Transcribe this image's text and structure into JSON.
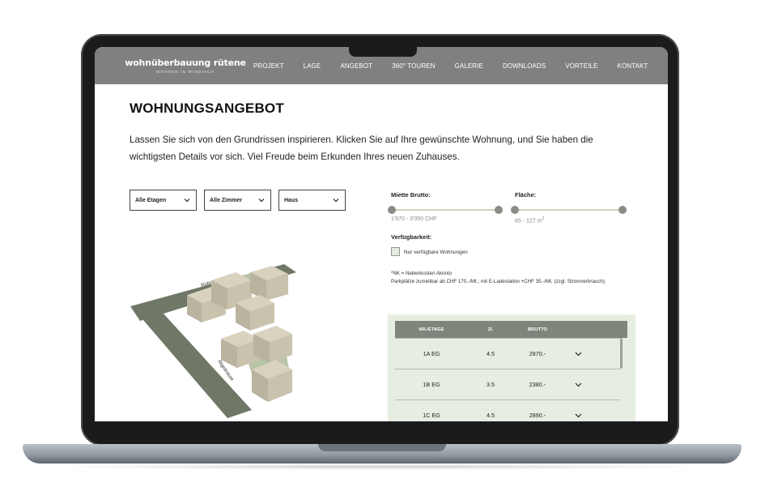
{
  "nav": {
    "logo_title": "wohnüberbauung rütene",
    "logo_subtitle": "WOHNEN IN WINDISCH",
    "items": [
      {
        "label": "PROJEKT"
      },
      {
        "label": "LAGE"
      },
      {
        "label": "ANGEBOT"
      },
      {
        "label": "360° TOUREN"
      },
      {
        "label": "GALERIE"
      },
      {
        "label": "DOWNLOADS"
      },
      {
        "label": "VORTEILE"
      },
      {
        "label": "KONTAKT"
      }
    ]
  },
  "page": {
    "title": "WOHNUNGSANGEBOT",
    "intro": "Lassen Sie sich von den Grundrissen inspirieren. Klicken Sie auf Ihre gewünschte Wohnung, und Sie haben die wichtigsten Details vor sich. Viel Freude beim Erkunden Ihres neuen Zuhauses."
  },
  "filters": {
    "etagen": "Alle Etagen",
    "zimmer": "Alle Zimmer",
    "haus": "Haus"
  },
  "sliders": {
    "miete": {
      "label": "Miette Brutto:",
      "value": "1'970 - 3'050 CHF"
    },
    "flaeche": {
      "label": "Fläche:",
      "value": "65 - 127 m",
      "unit_sup": "2"
    }
  },
  "availability": {
    "label": "Verfügbarkeit:",
    "checkbox_label": "Nur verfügbare Wohnungen"
  },
  "notes": {
    "line1": "*NK = Nebenkosten Akonto",
    "line2": "Parkplätze zumietbar ab CHF 170.-/Mt.; mit E-Ladestation +CHF 35.-/Mt. (zzgl. Stromverbrauch)."
  },
  "site_plan": {
    "street_1": "Rütenenstrasse",
    "street_2": "Rigistrasse"
  },
  "table": {
    "headers": {
      "nr": "NR./ETAGE",
      "zi": "ZI.",
      "brutto": "BRUTTO"
    },
    "rows": [
      {
        "nr": "1A EG",
        "zi": "4.5",
        "brutto": "2870.-"
      },
      {
        "nr": "1B EG",
        "zi": "3.5",
        "brutto": "2380.-"
      },
      {
        "nr": "1C EG",
        "zi": "4.5",
        "brutto": "2890.-"
      }
    ]
  },
  "colors": {
    "nav_bg": "#808080",
    "accent_green": "#7e857b",
    "table_bg": "#e6eee2"
  }
}
